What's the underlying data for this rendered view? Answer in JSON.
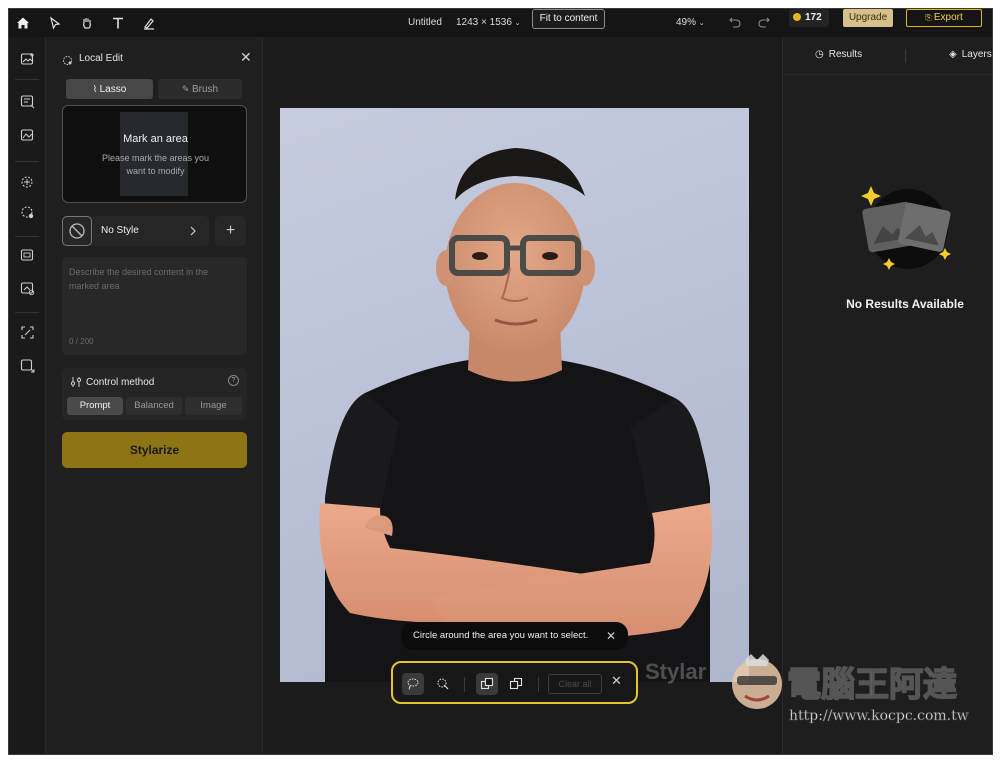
{
  "topbar": {
    "doc_title": "Untitled",
    "dimensions": "1243 × 1536",
    "fit_label": "Fit to content",
    "zoom": "49%",
    "credits": "172",
    "upgrade_label": "Upgrade",
    "export_label": "Export"
  },
  "panel": {
    "title": "Local Edit",
    "tabs": [
      {
        "label": "Lasso",
        "active": true
      },
      {
        "label": "Brush",
        "active": false
      }
    ],
    "preview": {
      "title": "Mark an area",
      "subtitle": "Please mark the areas you want to modify"
    },
    "style": {
      "label": "No Style"
    },
    "prompt": {
      "placeholder": "Describe the desired content in the marked area",
      "counter": "0 / 200"
    },
    "control": {
      "title": "Control method",
      "options": [
        "Prompt",
        "Balanced",
        "Image"
      ],
      "selected": "Prompt"
    },
    "submit_label": "Stylarize"
  },
  "canvas": {
    "tooltip": "Circle around the area you want to select.",
    "toolbar": {
      "clear_label": "Clear all"
    }
  },
  "right": {
    "tabs": [
      "Results",
      "Layers"
    ],
    "empty_text": "No Results Available"
  },
  "watermark": {
    "brand_text": "Stylar",
    "site_name": "電腦王阿達",
    "site_url": "http://www.kocpc.com.tw"
  },
  "colors": {
    "accent": "#e6c52a",
    "submit": "#8d7415",
    "upgrade": "#d7c08a"
  }
}
